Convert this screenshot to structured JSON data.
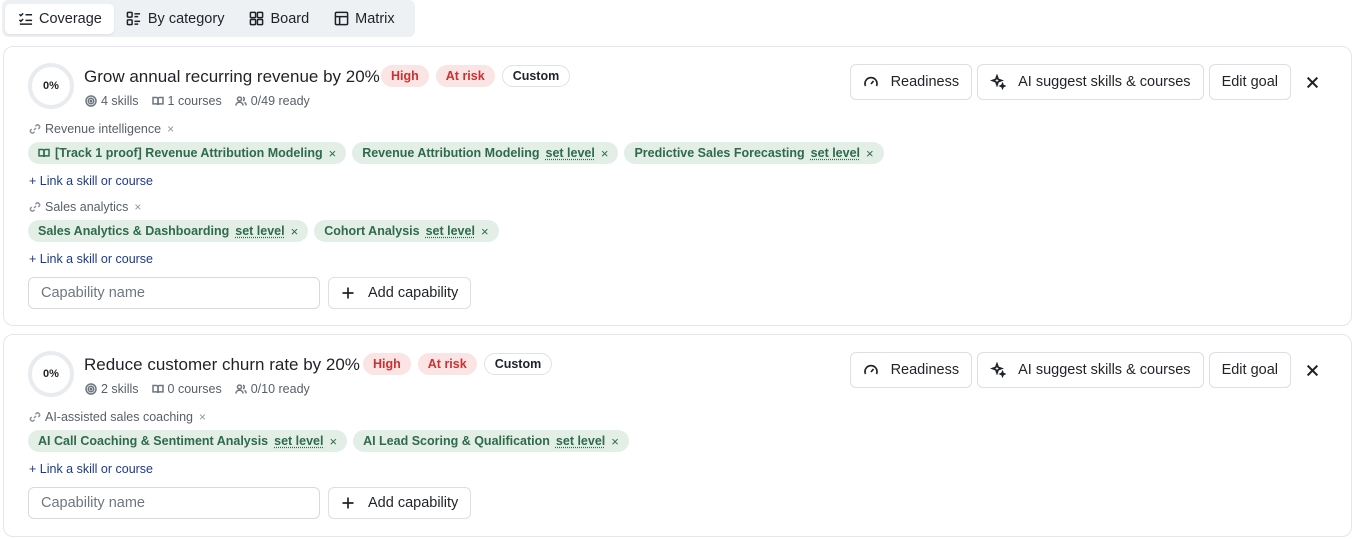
{
  "tabs": [
    {
      "label": "Coverage",
      "icon": "list-check-icon",
      "active": true
    },
    {
      "label": "By category",
      "icon": "category-list-icon",
      "active": false
    },
    {
      "label": "Board",
      "icon": "board-grid-icon",
      "active": false
    },
    {
      "label": "Matrix",
      "icon": "table-icon",
      "active": false
    }
  ],
  "colors": {
    "chip_bg": "#e3eee7",
    "chip_text": "#2e6b4a",
    "risk_bg": "#fbe4e4",
    "risk_text": "#c93232",
    "link": "#1d3a8a"
  },
  "goals": [
    {
      "progress": "0%",
      "title": "Grow annual recurring revenue by 20%",
      "badges": {
        "priority": "High",
        "status": "At risk",
        "type": "Custom"
      },
      "meta": {
        "skills": "4 skills",
        "courses": "1 courses",
        "ready": "0/49 ready"
      },
      "actions": {
        "readiness": "Readiness",
        "ai_suggest": "AI suggest skills & courses",
        "edit": "Edit goal"
      },
      "capabilities": [
        {
          "name": "Revenue intelligence",
          "remove": "×",
          "items": [
            {
              "label": "[Track 1 proof] Revenue Attribution Modeling",
              "kind": "course",
              "set_level": "",
              "remove": "×"
            },
            {
              "label": "Revenue Attribution Modeling",
              "kind": "skill",
              "set_level": "set level",
              "remove": "×"
            },
            {
              "label": "Predictive Sales Forecasting",
              "kind": "skill",
              "set_level": "set level",
              "remove": "×"
            }
          ],
          "link_label": "+ Link a skill or course"
        },
        {
          "name": "Sales analytics",
          "remove": "×",
          "items": [
            {
              "label": "Sales Analytics & Dashboarding",
              "kind": "skill",
              "set_level": "set level",
              "remove": "×"
            },
            {
              "label": "Cohort Analysis",
              "kind": "skill",
              "set_level": "set level",
              "remove": "×"
            }
          ],
          "link_label": "+ Link a skill or course"
        }
      ],
      "capability_input": {
        "placeholder": "Capability name",
        "value": ""
      },
      "add_capability_label": "Add capability"
    },
    {
      "progress": "0%",
      "title": "Reduce customer churn rate by 20%",
      "badges": {
        "priority": "High",
        "status": "At risk",
        "type": "Custom"
      },
      "meta": {
        "skills": "2 skills",
        "courses": "0 courses",
        "ready": "0/10 ready"
      },
      "actions": {
        "readiness": "Readiness",
        "ai_suggest": "AI suggest skills & courses",
        "edit": "Edit goal"
      },
      "capabilities": [
        {
          "name": "AI-assisted sales coaching",
          "remove": "×",
          "items": [
            {
              "label": "AI Call Coaching & Sentiment Analysis",
              "kind": "skill",
              "set_level": "set level",
              "remove": "×"
            },
            {
              "label": "AI Lead Scoring & Qualification",
              "kind": "skill",
              "set_level": "set level",
              "remove": "×"
            }
          ],
          "link_label": "+ Link a skill or course"
        }
      ],
      "capability_input": {
        "placeholder": "Capability name",
        "value": ""
      },
      "add_capability_label": "Add capability"
    }
  ]
}
